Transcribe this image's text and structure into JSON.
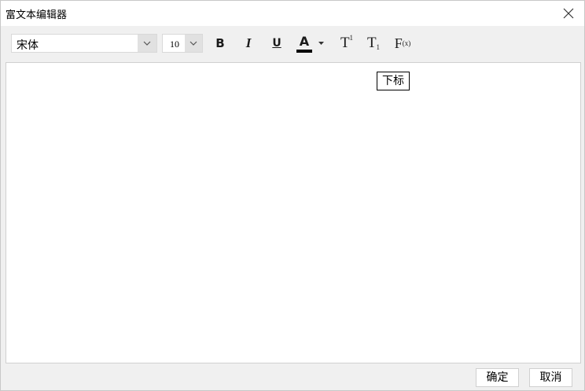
{
  "window": {
    "title": "富文本编辑器",
    "close_icon": "close-icon"
  },
  "toolbar": {
    "font_family": {
      "selected": "宋体",
      "icon": "chevron-down-icon"
    },
    "font_size": {
      "selected": "10",
      "icon": "chevron-down-icon"
    },
    "bold_label": "B",
    "italic_label": "I",
    "underline_label": "U",
    "font_color": {
      "label": "A",
      "color": "#000000",
      "icon": "caret-down-icon"
    },
    "superscript": {
      "base": "T",
      "mark": "1"
    },
    "subscript": {
      "base": "T",
      "mark": "1"
    },
    "formula": {
      "base": "F",
      "mark": "(x)"
    }
  },
  "editor": {
    "content": ""
  },
  "tooltip": {
    "text": "下标"
  },
  "footer": {
    "ok_label": "确定",
    "cancel_label": "取消"
  }
}
